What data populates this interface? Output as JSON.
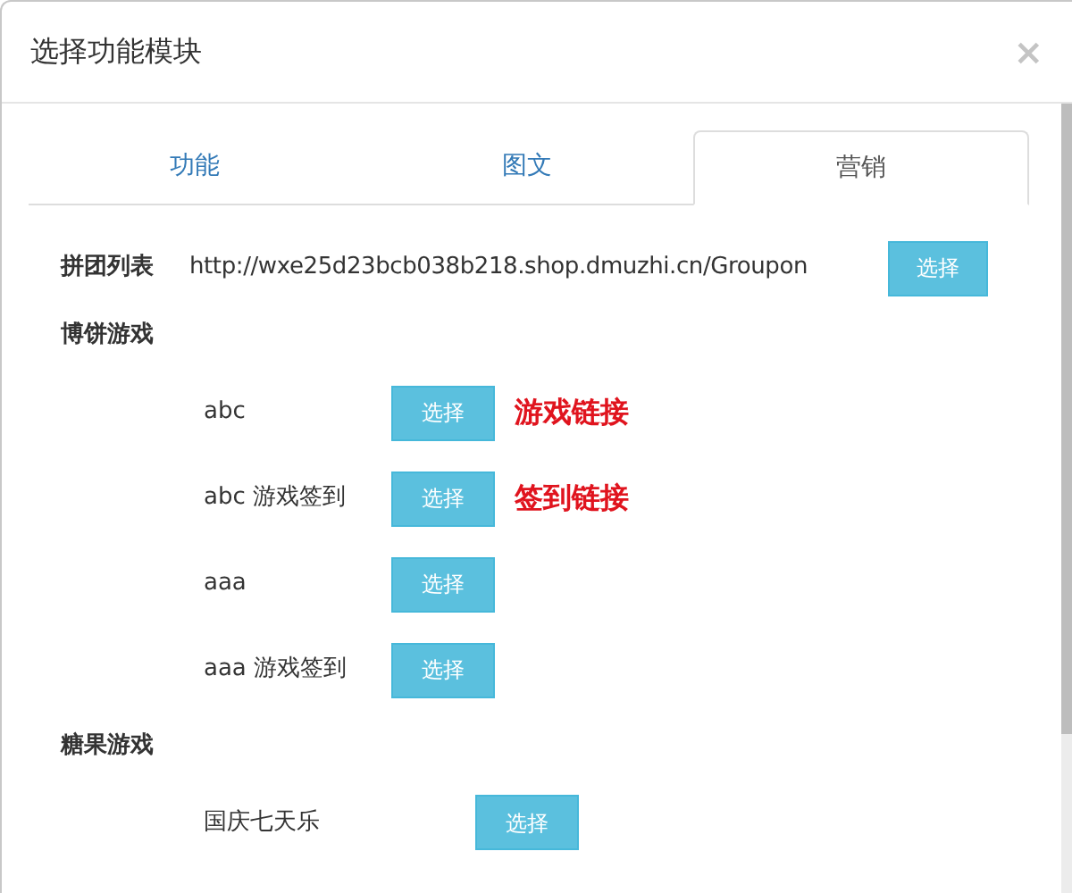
{
  "dialog": {
    "title": "选择功能模块",
    "close": "×"
  },
  "tabs": [
    {
      "label": "功能",
      "selected": false
    },
    {
      "label": "图文",
      "selected": false
    },
    {
      "label": "营销",
      "selected": true
    }
  ],
  "groupon": {
    "label": "拼团列表",
    "url": "http://wxe25d23bcb038b218.shop.dmuzhi.cn/Groupon",
    "button": "选择"
  },
  "groups": [
    {
      "title": "博饼游戏",
      "items": [
        {
          "label": "abc",
          "button": "选择",
          "note": "游戏链接"
        },
        {
          "label": "abc 游戏签到",
          "button": "选择",
          "note": "签到链接"
        },
        {
          "label": "aaa",
          "button": "选择"
        },
        {
          "label": "aaa 游戏签到",
          "button": "选择"
        }
      ]
    },
    {
      "title": "糖果游戏",
      "items": [
        {
          "label": "国庆七天乐",
          "button": "选择"
        }
      ]
    }
  ]
}
